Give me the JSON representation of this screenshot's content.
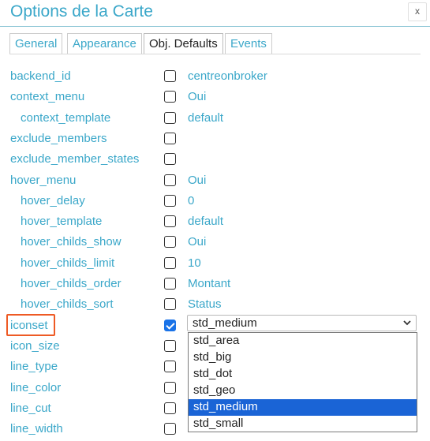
{
  "dialog": {
    "title": "Options de la Carte",
    "close_label": "x"
  },
  "tabs": [
    {
      "label": "General",
      "active": false
    },
    {
      "label": "Appearance",
      "active": false
    },
    {
      "label": "Obj. Defaults",
      "active": true
    },
    {
      "label": "Events",
      "active": false
    }
  ],
  "options": [
    {
      "label": "backend_id",
      "checked": false,
      "value": "centreonbroker"
    },
    {
      "label": "context_menu",
      "checked": false,
      "value": "Oui"
    },
    {
      "label": "context_template",
      "checked": false,
      "value": "default"
    },
    {
      "label": "exclude_members",
      "checked": false,
      "value": ""
    },
    {
      "label": "exclude_member_states",
      "checked": false,
      "value": ""
    },
    {
      "label": "hover_menu",
      "checked": false,
      "value": "Oui"
    },
    {
      "label": "hover_delay",
      "checked": false,
      "value": "0"
    },
    {
      "label": "hover_template",
      "checked": false,
      "value": "default"
    },
    {
      "label": "hover_childs_show",
      "checked": false,
      "value": "Oui"
    },
    {
      "label": "hover_childs_limit",
      "checked": false,
      "value": "10"
    },
    {
      "label": "hover_childs_order",
      "checked": false,
      "value": "Montant"
    },
    {
      "label": "hover_childs_sort",
      "checked": false,
      "value": "Status"
    },
    {
      "label": "iconset",
      "checked": true,
      "value": ""
    },
    {
      "label": "icon_size",
      "checked": false,
      "value": ""
    },
    {
      "label": "line_type",
      "checked": false,
      "value": ""
    },
    {
      "label": "line_color",
      "checked": false,
      "value": ""
    },
    {
      "label": "line_cut",
      "checked": false,
      "value": ""
    },
    {
      "label": "line_width",
      "checked": false,
      "value": ""
    }
  ],
  "iconset_select": {
    "selected": "std_medium",
    "options": [
      "std_area",
      "std_big",
      "std_dot",
      "std_geo",
      "std_medium",
      "std_small"
    ]
  },
  "colors": {
    "accent": "#3aa7c9",
    "highlight_border": "#ee5a24",
    "selected_option_bg": "#1a64d6"
  }
}
